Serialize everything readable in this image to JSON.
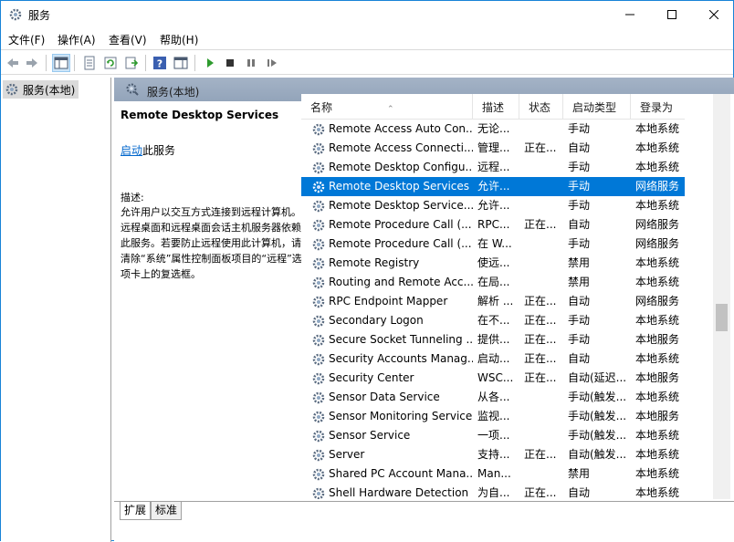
{
  "window": {
    "title": "服务"
  },
  "menu": [
    "文件(F)",
    "操作(A)",
    "查看(V)",
    "帮助(H)"
  ],
  "toolbar": {
    "buttons": [
      "back-icon",
      "forward-icon",
      "show-hide-tree-icon",
      "properties-icon",
      "refresh-icon",
      "export-list-icon",
      "help-icon",
      "show-hide-action-pane-icon",
      "start-icon",
      "stop-icon",
      "pause-icon",
      "restart-icon"
    ]
  },
  "tree": {
    "root_label": "服务(本地)"
  },
  "pane": {
    "header_title": "服务(本地)"
  },
  "detail": {
    "service_name": "Remote Desktop Services",
    "start_link": "启动",
    "start_suffix": "此服务",
    "desc_label": "描述:",
    "desc_text": "允许用户以交互方式连接到远程计算机。远程桌面和远程桌面会话主机服务器依赖此服务。若要防止远程使用此计算机，请清除“系统”属性控制面板项目的“远程”选项卡上的复选框。"
  },
  "columns": {
    "name": "名称",
    "desc": "描述",
    "status": "状态",
    "start_type": "启动类型",
    "logon": "登录为"
  },
  "rows": [
    {
      "name": "Remote Access Auto Con...",
      "desc": "无论...",
      "status": "",
      "start_type": "手动",
      "logon": "本地系统",
      "selected": false
    },
    {
      "name": "Remote Access Connecti...",
      "desc": "管理...",
      "status": "正在...",
      "start_type": "自动",
      "logon": "本地系统",
      "selected": false
    },
    {
      "name": "Remote Desktop Configu...",
      "desc": "远程...",
      "status": "",
      "start_type": "手动",
      "logon": "本地系统",
      "selected": false
    },
    {
      "name": "Remote Desktop Services",
      "desc": "允许...",
      "status": "",
      "start_type": "手动",
      "logon": "网络服务",
      "selected": true
    },
    {
      "name": "Remote Desktop Service...",
      "desc": "允许...",
      "status": "",
      "start_type": "手动",
      "logon": "本地系统",
      "selected": false
    },
    {
      "name": "Remote Procedure Call (...",
      "desc": "RPC...",
      "status": "正在...",
      "start_type": "自动",
      "logon": "网络服务",
      "selected": false
    },
    {
      "name": "Remote Procedure Call (...",
      "desc": "在 W...",
      "status": "",
      "start_type": "手动",
      "logon": "网络服务",
      "selected": false
    },
    {
      "name": "Remote Registry",
      "desc": "使远...",
      "status": "",
      "start_type": "禁用",
      "logon": "本地系统",
      "selected": false
    },
    {
      "name": "Routing and Remote Acc...",
      "desc": "在局...",
      "status": "",
      "start_type": "禁用",
      "logon": "本地系统",
      "selected": false
    },
    {
      "name": "RPC Endpoint Mapper",
      "desc": "解析 ...",
      "status": "正在...",
      "start_type": "自动",
      "logon": "网络服务",
      "selected": false
    },
    {
      "name": "Secondary Logon",
      "desc": "在不...",
      "status": "正在...",
      "start_type": "手动",
      "logon": "本地系统",
      "selected": false
    },
    {
      "name": "Secure Socket Tunneling ...",
      "desc": "提供...",
      "status": "正在...",
      "start_type": "手动",
      "logon": "本地服务",
      "selected": false
    },
    {
      "name": "Security Accounts Manag...",
      "desc": "启动...",
      "status": "正在...",
      "start_type": "自动",
      "logon": "本地系统",
      "selected": false
    },
    {
      "name": "Security Center",
      "desc": "WSC...",
      "status": "正在...",
      "start_type": "自动(延迟...",
      "logon": "本地服务",
      "selected": false
    },
    {
      "name": "Sensor Data Service",
      "desc": "从各...",
      "status": "",
      "start_type": "手动(触发...",
      "logon": "本地系统",
      "selected": false
    },
    {
      "name": "Sensor Monitoring Service",
      "desc": "监视...",
      "status": "",
      "start_type": "手动(触发...",
      "logon": "本地服务",
      "selected": false
    },
    {
      "name": "Sensor Service",
      "desc": "一项...",
      "status": "",
      "start_type": "手动(触发...",
      "logon": "本地系统",
      "selected": false
    },
    {
      "name": "Server",
      "desc": "支持...",
      "status": "正在...",
      "start_type": "自动(触发...",
      "logon": "本地系统",
      "selected": false
    },
    {
      "name": "Shared PC Account Mana...",
      "desc": "Man...",
      "status": "",
      "start_type": "禁用",
      "logon": "本地系统",
      "selected": false
    },
    {
      "name": "Shell Hardware Detection",
      "desc": "为自...",
      "status": "正在...",
      "start_type": "自动",
      "logon": "本地系统",
      "selected": false
    }
  ],
  "tabs": [
    "扩展",
    "标准"
  ],
  "colors": {
    "selection": "#0078d7",
    "link": "#0066cc",
    "pane_header": "#a4b3c6"
  }
}
